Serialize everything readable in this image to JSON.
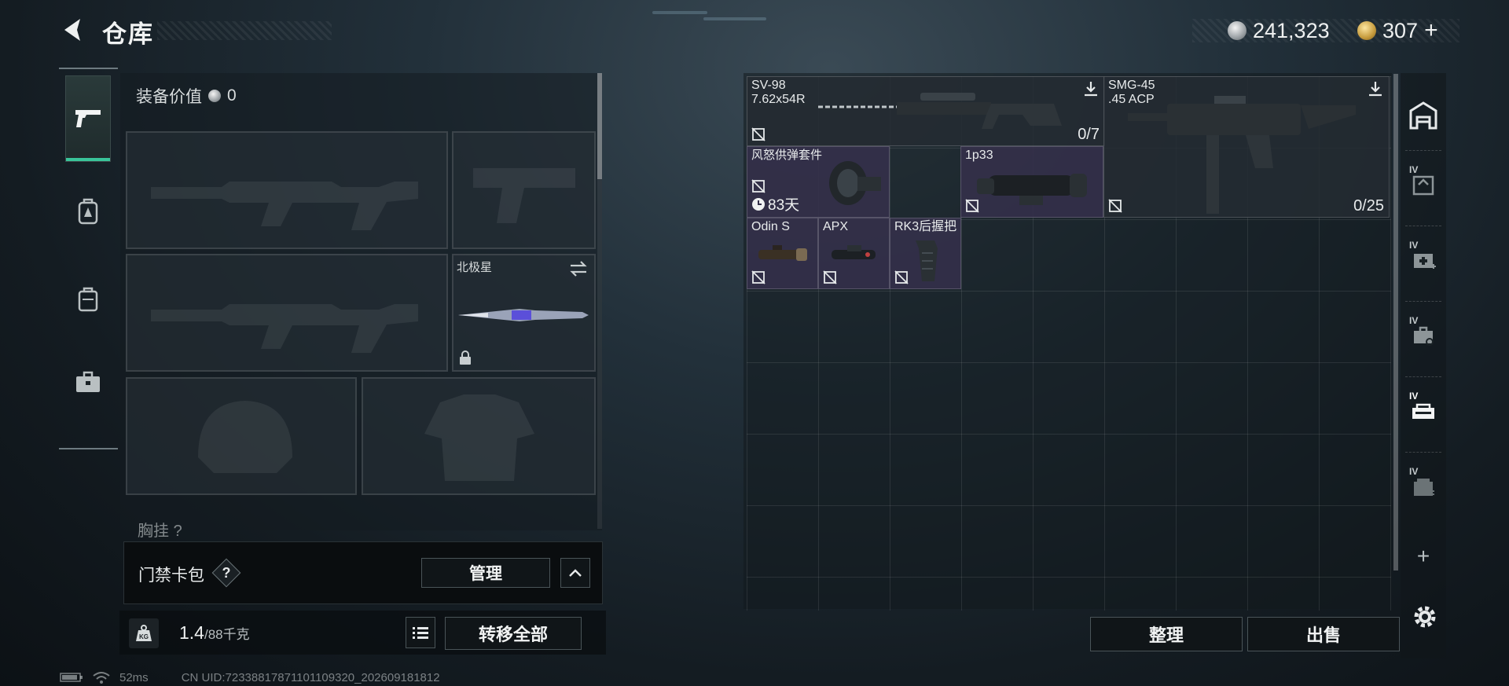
{
  "header": {
    "title": "仓库",
    "currencies": [
      {
        "icon": "silver-coin-icon",
        "value": "241,323"
      },
      {
        "icon": "gold-coin-icon",
        "value": "307",
        "add_label": "+"
      }
    ]
  },
  "left_nav": {
    "tabs": [
      {
        "icon": "pistol-icon",
        "active": true
      },
      {
        "icon": "backpack-icon",
        "active": false
      },
      {
        "icon": "rig-icon",
        "active": false
      },
      {
        "icon": "toolbox-icon",
        "active": false
      }
    ]
  },
  "loadout": {
    "equip_value_label": "装备价值",
    "equip_value": "0",
    "melee_slot_label": "北极星",
    "chest_label": "胸挂",
    "chest_help": "?"
  },
  "keycard": {
    "label": "门禁卡包",
    "help": "?",
    "manage_label": "管理"
  },
  "capacity": {
    "current": "1.4",
    "max": "/88千克",
    "transfer_all_label": "转移全部"
  },
  "storage": {
    "items": [
      {
        "name": "SV-98",
        "ammo": "7.62x54R",
        "count": "0/7"
      },
      {
        "name": "SMG-45",
        "ammo": ".45 ACP",
        "count": "0/25"
      },
      {
        "name": "风怒供弹套件",
        "timer": "83天"
      },
      {
        "name": "1p33"
      },
      {
        "name": "Odin S"
      },
      {
        "name": "APX"
      },
      {
        "name": "RK3后握把"
      }
    ],
    "sort_label": "整理",
    "sell_label": "出售"
  },
  "side_tabs": {
    "level_label": "IV",
    "add_label": "+"
  },
  "status": {
    "ping": "52ms",
    "uid": "CN UID:72338817871101109320_202609181812"
  },
  "colors": {
    "accent": "#39c59a",
    "purple_item": "#34304a"
  }
}
